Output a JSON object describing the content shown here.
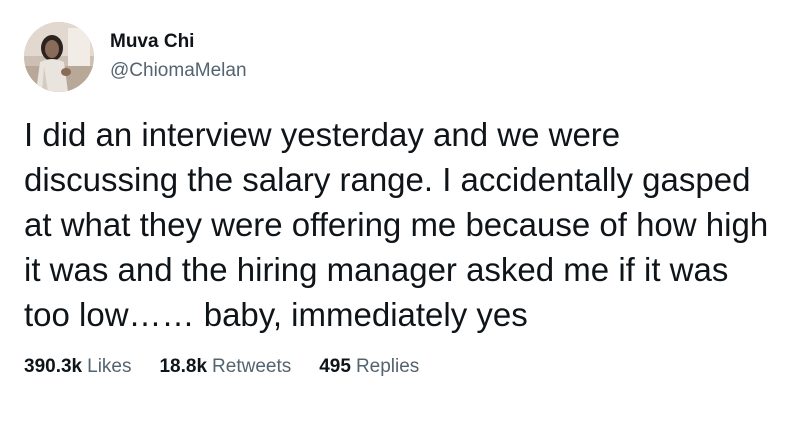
{
  "author": {
    "display_name": "Muva Chi",
    "handle": "@ChiomaMelan",
    "avatar_icon": "user-photo-avatar"
  },
  "tweet": {
    "lines": [
      "I did an interview yesterday and we were",
      "discussing the salary range. I accidentally gasped",
      "at what they were offering me because of how high",
      "it was and the hiring manager asked me if it was",
      "too low…… baby, immediately yes"
    ]
  },
  "stats": {
    "likes": {
      "value": "390.3k",
      "label": "Likes"
    },
    "retweets": {
      "value": "18.8k",
      "label": "Retweets"
    },
    "replies": {
      "value": "495",
      "label": "Replies"
    }
  },
  "colors": {
    "text_primary": "#0f1419",
    "text_secondary": "#536471",
    "background": "#ffffff"
  }
}
